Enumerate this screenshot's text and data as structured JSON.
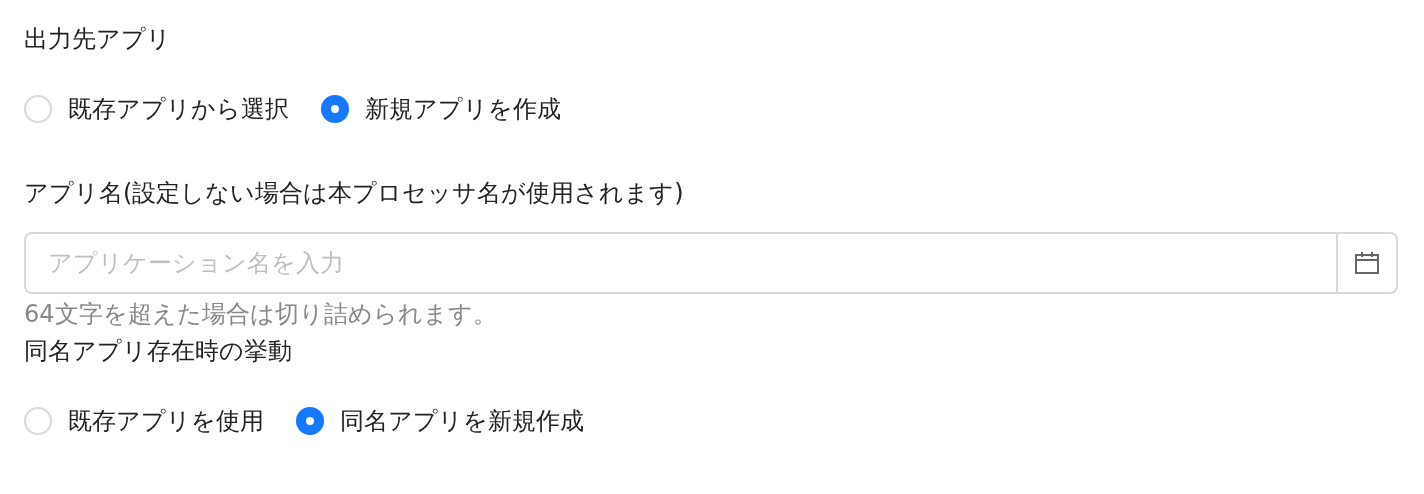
{
  "output_app": {
    "label": "出力先アプリ",
    "options": [
      {
        "label": "既存アプリから選択",
        "selected": false
      },
      {
        "label": "新規アプリを作成",
        "selected": true
      }
    ]
  },
  "app_name": {
    "label": "アプリ名(設定しない場合は本プロセッサ名が使用されます)",
    "placeholder": "アプリケーション名を入力",
    "help": "64文字を超えた場合は切り詰められます。"
  },
  "same_name_behavior": {
    "label": "同名アプリ存在時の挙動",
    "options": [
      {
        "label": "既存アプリを使用",
        "selected": false
      },
      {
        "label": "同名アプリを新規作成",
        "selected": true
      }
    ]
  }
}
